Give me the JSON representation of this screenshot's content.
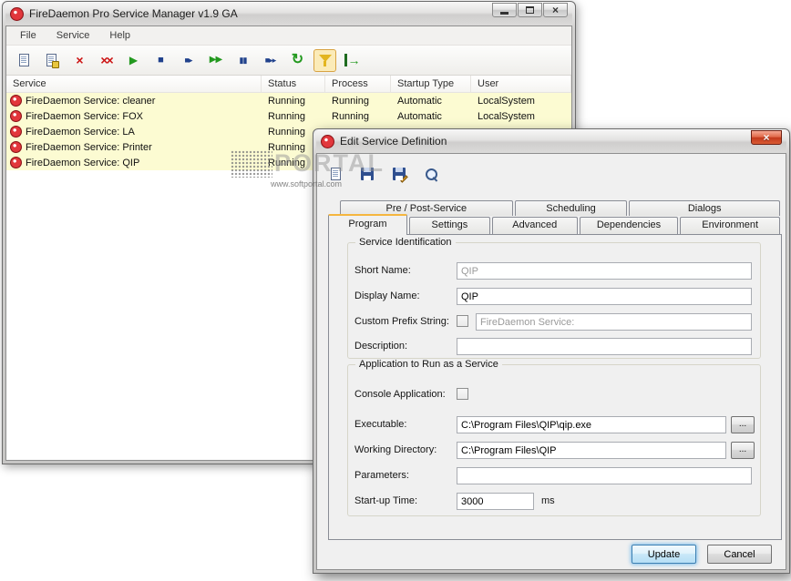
{
  "watermark": {
    "brand": "PORTAL",
    "url": "www.softportal.com"
  },
  "main_window": {
    "title": "FireDaemon Pro Service Manager v1.9 GA",
    "menu": [
      "File",
      "Service",
      "Help"
    ],
    "toolbar": [
      {
        "name": "new-service",
        "glyph": ""
      },
      {
        "name": "edit-service",
        "glyph": ""
      },
      {
        "name": "delete-service",
        "glyph": "×"
      },
      {
        "name": "uninstall-all",
        "glyph": "××"
      },
      {
        "name": "start-service",
        "glyph": "▶"
      },
      {
        "name": "stop-service",
        "glyph": "■"
      },
      {
        "name": "restart-service",
        "glyph": "■▸"
      },
      {
        "name": "start-all",
        "glyph": "▶▶"
      },
      {
        "name": "stop-all",
        "glyph": "▮▮"
      },
      {
        "name": "restart-all",
        "glyph": "■▸▸"
      },
      {
        "name": "refresh",
        "glyph": "↻"
      },
      {
        "name": "filter",
        "glyph": ""
      },
      {
        "name": "exit",
        "glyph": "→"
      }
    ],
    "columns": [
      "Service",
      "Status",
      "Process",
      "Startup Type",
      "User"
    ],
    "rows": [
      {
        "service": "FireDaemon Service: cleaner",
        "status": "Running",
        "process": "Running",
        "startup": "Automatic",
        "user": "LocalSystem"
      },
      {
        "service": "FireDaemon Service: FOX",
        "status": "Running",
        "process": "Running",
        "startup": "Automatic",
        "user": "LocalSystem"
      },
      {
        "service": "FireDaemon Service: LA",
        "status": "Running",
        "process": "",
        "startup": "",
        "user": ""
      },
      {
        "service": "FireDaemon Service: Printer",
        "status": "Running",
        "process": "",
        "startup": "",
        "user": ""
      },
      {
        "service": "FireDaemon Service: QIP",
        "status": "Running",
        "process": "",
        "startup": "",
        "user": ""
      }
    ]
  },
  "dialog": {
    "title": "Edit Service Definition",
    "tabs_back": [
      "Pre / Post-Service",
      "Scheduling",
      "Dialogs"
    ],
    "tabs_front": [
      "Program",
      "Settings",
      "Advanced",
      "Dependencies",
      "Environment"
    ],
    "active_tab": "Program",
    "group1_title": "Service Identification",
    "group2_title": "Application to Run as a Service",
    "fields": {
      "short_name": {
        "label": "Short Name:",
        "value": "QIP"
      },
      "display_name": {
        "label": "Display Name:",
        "value": "QIP"
      },
      "custom_prefix": {
        "label": "Custom Prefix String:",
        "value": "FireDaemon Service:"
      },
      "description": {
        "label": "Description:",
        "value": ""
      },
      "console_app": {
        "label": "Console Application:"
      },
      "executable": {
        "label": "Executable:",
        "value": "C:\\Program Files\\QIP\\qip.exe"
      },
      "working_dir": {
        "label": "Working Directory:",
        "value": "C:\\Program Files\\QIP"
      },
      "parameters": {
        "label": "Parameters:",
        "value": ""
      },
      "startup_time": {
        "label": "Start-up Time:",
        "value": "3000",
        "unit": "ms"
      }
    },
    "browse_label": "...",
    "update_label": "Update",
    "cancel_label": "Cancel"
  }
}
